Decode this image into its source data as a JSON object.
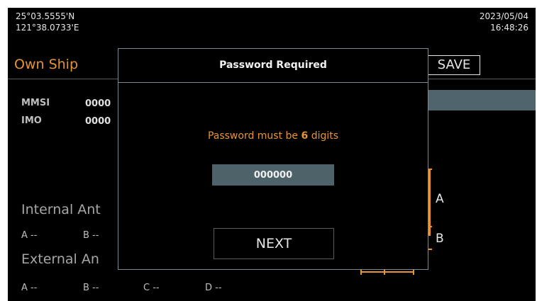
{
  "status": {
    "lat": "25°03.5555'N",
    "lon": "121°38.0733'E",
    "date": "2023/05/04",
    "time": "16:48:26"
  },
  "page": {
    "title": "Own Ship",
    "save_label": "SAVE"
  },
  "fields": {
    "mmsi_label": "MMSI",
    "mmsi_value": "0000",
    "imo_label": "IMO",
    "imo_value": "0000"
  },
  "internal_antenna": {
    "label": "Internal Ant",
    "items": [
      "A --",
      "B --"
    ]
  },
  "external_antenna": {
    "label": "External An",
    "items": [
      "A --",
      "B --",
      "C --",
      "D --"
    ]
  },
  "diagram": {
    "label_a": "A",
    "label_b": "B"
  },
  "dialog": {
    "title": "Password Required",
    "message_prefix": "Password must be ",
    "message_number": "6",
    "message_suffix": " digits",
    "password_value": "000000",
    "next_label": "NEXT"
  },
  "colors": {
    "accent": "#e69434",
    "input_bg": "#4e6269",
    "background": "#000000"
  }
}
